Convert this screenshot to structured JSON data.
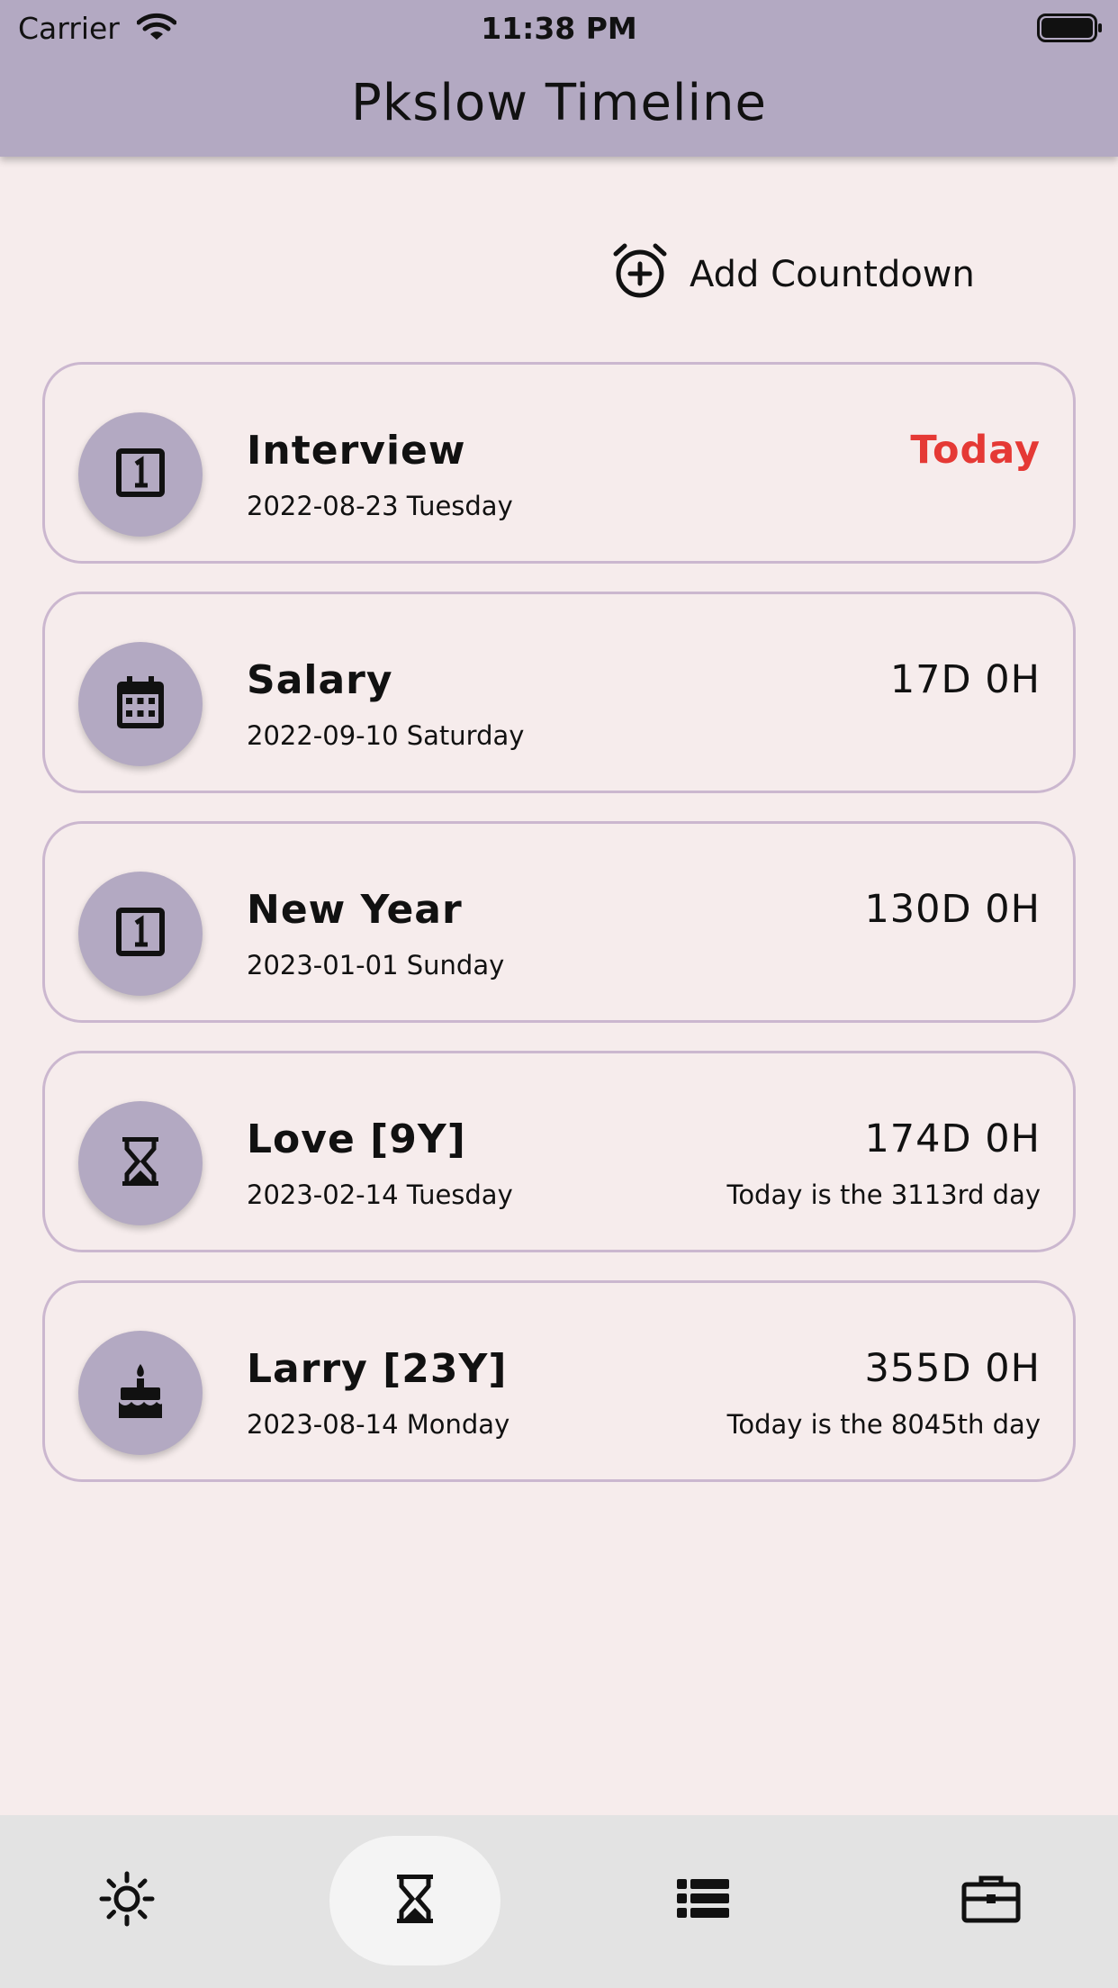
{
  "status_bar": {
    "carrier": "Carrier",
    "time": "11:38 PM"
  },
  "app_bar": {
    "title": "Pkslow Timeline"
  },
  "actions": {
    "add_countdown": "Add Countdown"
  },
  "colors": {
    "accent": "#b3a9c2",
    "today": "#e53935",
    "background": "#f6ecec",
    "card_border": "#cbb7cf"
  },
  "countdowns": [
    {
      "icon": "calendar-one-icon",
      "name": "Interview",
      "date": "2022-08-23 Tuesday",
      "remaining": "Today",
      "since": ""
    },
    {
      "icon": "calendar-month-icon",
      "name": "Salary",
      "date": "2022-09-10 Saturday",
      "remaining": "17D 0H",
      "since": ""
    },
    {
      "icon": "calendar-one-icon",
      "name": "New Year",
      "date": "2023-01-01 Sunday",
      "remaining": "130D 0H",
      "since": ""
    },
    {
      "icon": "hourglass-icon",
      "name": "Love [9Y]",
      "date": "2023-02-14 Tuesday",
      "remaining": "174D 0H",
      "since": "Today is the 3113rd day"
    },
    {
      "icon": "cake-icon",
      "name": "Larry [23Y]",
      "date": "2023-08-14 Monday",
      "remaining": "355D 0H",
      "since": "Today is the 8045th day"
    }
  ],
  "bottom_nav": [
    {
      "icon": "sun-icon",
      "active": false
    },
    {
      "icon": "hourglass-icon",
      "active": true
    },
    {
      "icon": "list-icon",
      "active": false
    },
    {
      "icon": "briefcase-icon",
      "active": false
    }
  ]
}
